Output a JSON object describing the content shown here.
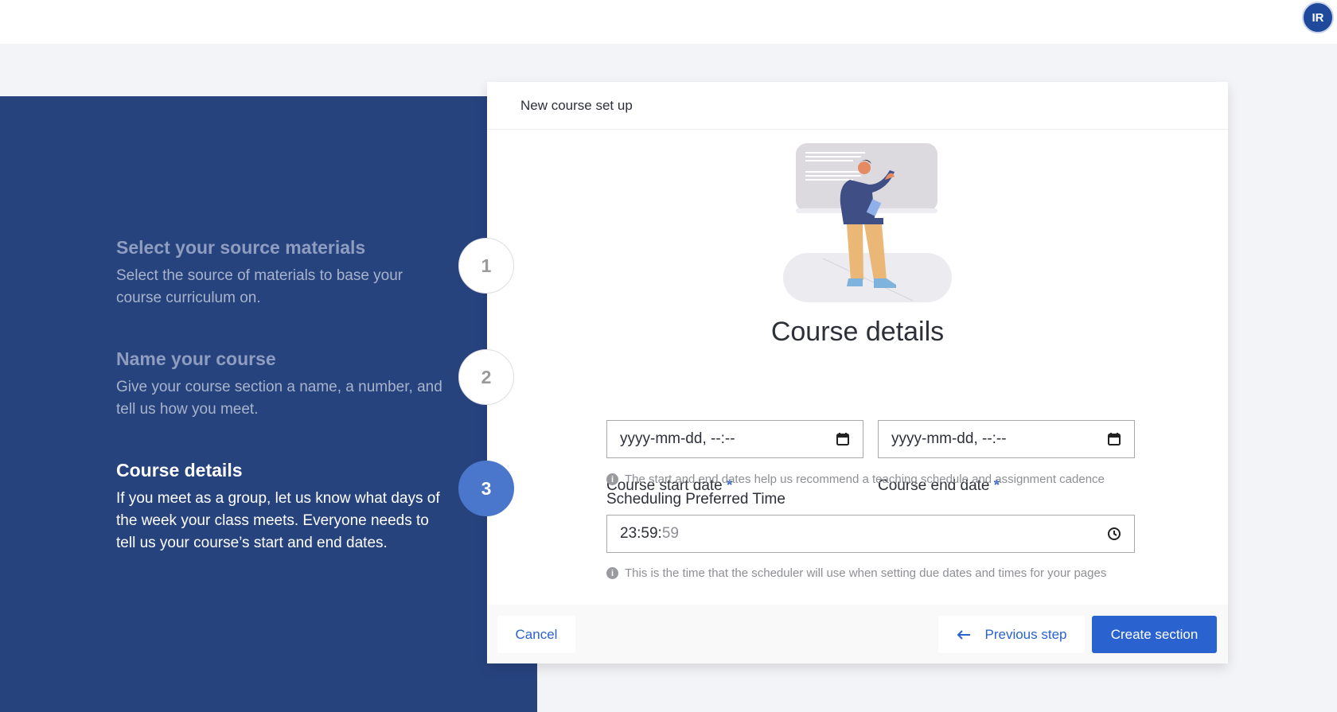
{
  "user": {
    "initials": "IR"
  },
  "steps": [
    {
      "number": "1",
      "title": "Select your source materials",
      "description": "Select the source of materials to base your course curriculum on.",
      "active": false
    },
    {
      "number": "2",
      "title": "Name your course",
      "description": "Give your course section a name, a number, and tell us how you meet.",
      "active": false
    },
    {
      "number": "3",
      "title": "Course details",
      "description": "If you meet as a group, let us know what days of the week your class meets. Everyone needs to tell us your course’s start and end dates.",
      "active": true
    }
  ],
  "card": {
    "header": "New course set up",
    "title": "Course details",
    "start_date": {
      "label": "Course start date",
      "required": "*",
      "placeholder": "yyyy-mm-dd, --:--"
    },
    "end_date": {
      "label": "Course end date",
      "required": "*",
      "placeholder": "yyyy-mm-dd, --:--"
    },
    "dates_hint": "The start and end dates help us recommend a teaching schedule and assignment cadence",
    "time": {
      "label": "Scheduling Preferred Time",
      "value_main": "23:59:",
      "value_seconds": "59"
    },
    "time_hint": "This is the time that the scheduler will use when setting due dates and times for your pages",
    "info_glyph": "i"
  },
  "footer": {
    "cancel": "Cancel",
    "previous": "Previous step",
    "create": "Create section"
  },
  "colors": {
    "panel": "#27437e",
    "accent": "#2a62d0",
    "active_step": "#4a76cb"
  }
}
